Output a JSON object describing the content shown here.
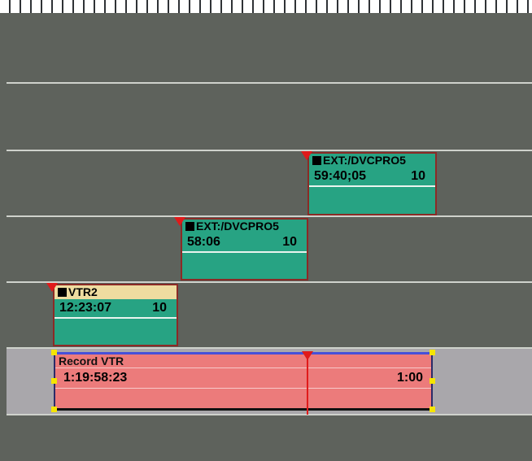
{
  "timeline": {
    "clips": [
      {
        "source": "EXT:/DVCPRO5",
        "timecode": "59:40;05",
        "count": "10"
      },
      {
        "source": "EXT:/DVCPRO5",
        "timecode": "58:06",
        "count": "10"
      },
      {
        "source": "VTR2",
        "timecode": "12:23:07",
        "count": "10"
      }
    ],
    "record": {
      "label": "Record VTR",
      "timecode": "1:19:58:23",
      "duration": "1:00"
    }
  },
  "colors": {
    "track_bg": "#5e625c",
    "clip_teal": "#27a383",
    "clip_border": "#8b2a26",
    "clip_header_yellow": "#efdca0",
    "record_clip": "#ec7b7b",
    "record_track": "#a9a7ab",
    "marker_red": "#e01a1a",
    "handle_yellow": "#f5e500"
  }
}
